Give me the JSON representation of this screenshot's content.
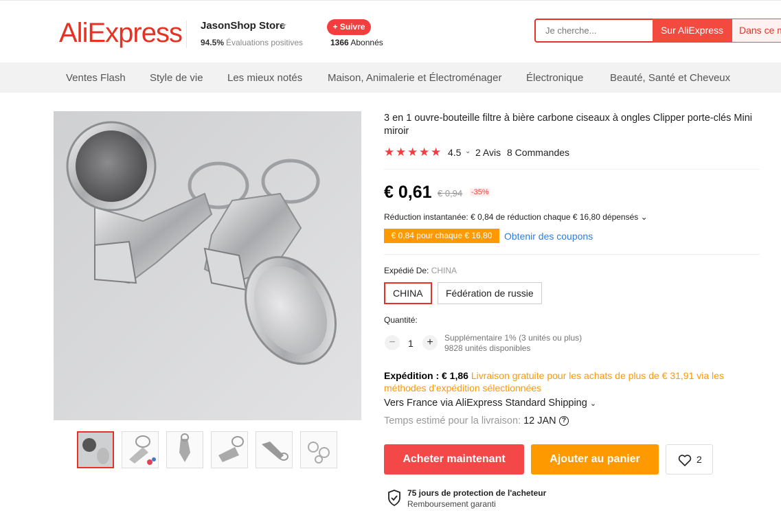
{
  "header": {
    "logo": "AliExpress",
    "store_name": "JasonShop Store",
    "rating_pct": "94.5%",
    "rating_text": "Évaluations positives",
    "follow_label": "+ Suivre",
    "followers_count": "1366",
    "followers_label": "Abonnés",
    "search": {
      "placeholder": "Je cherche...",
      "btn_aliexpress": "Sur AliExpress",
      "btn_store": "Dans ce m"
    }
  },
  "nav": {
    "items": [
      "Ventes Flash",
      "Style de vie",
      "Les mieux notés",
      "Maison, Animalerie et Électroménager",
      "Électronique",
      "Beauté, Santé et Cheveux"
    ]
  },
  "product": {
    "title": "3 en 1 ouvre-bouteille filtre à bière carbone ciseaux à ongles Clipper porte-clés Mini miroir",
    "rating": "4.5",
    "stars": 5,
    "reviews": "2 Avis",
    "orders": "8 Commandes",
    "price": "€ 0,61",
    "old_price": "€ 0,94",
    "discount": "-35%",
    "instant_discount": "Réduction instantanée: € 0,84 de réduction chaque € 16,80 dépensés",
    "coupon_tag": "€ 0,84 pour chaque € 16,80",
    "coupon_link": "Obtenir des coupons",
    "ship_from_label": "Expédié De:",
    "ship_from_value": "CHINA",
    "ship_options": [
      "CHINA",
      "Fédération de russie"
    ],
    "quantity_label": "Quantité:",
    "quantity": "1",
    "quantity_note_1": "Supplémentaire 1% (3 unités ou plus)",
    "quantity_note_2": "9828 unités disponibles",
    "shipping_label": "Expédition : € 1,86",
    "shipping_free": "Livraison gratuite pour les achats de plus de € 31,91 via les méthodes d'expédition sélectionnées",
    "shipping_via": "Vers France via AliExpress Standard Shipping",
    "delivery_label": "Temps estimé pour la livraison:",
    "delivery_date": "12 JAN",
    "buy_label": "Acheter maintenant",
    "cart_label": "Ajouter au panier",
    "wishlist_count": "2",
    "protection_title": "75 jours de protection de l'acheteur",
    "protection_sub": "Remboursement garanti"
  },
  "colors": {
    "brand": "#e43225",
    "buy": "#f44848",
    "cart": "#ff9900",
    "link": "#2e7de1"
  }
}
